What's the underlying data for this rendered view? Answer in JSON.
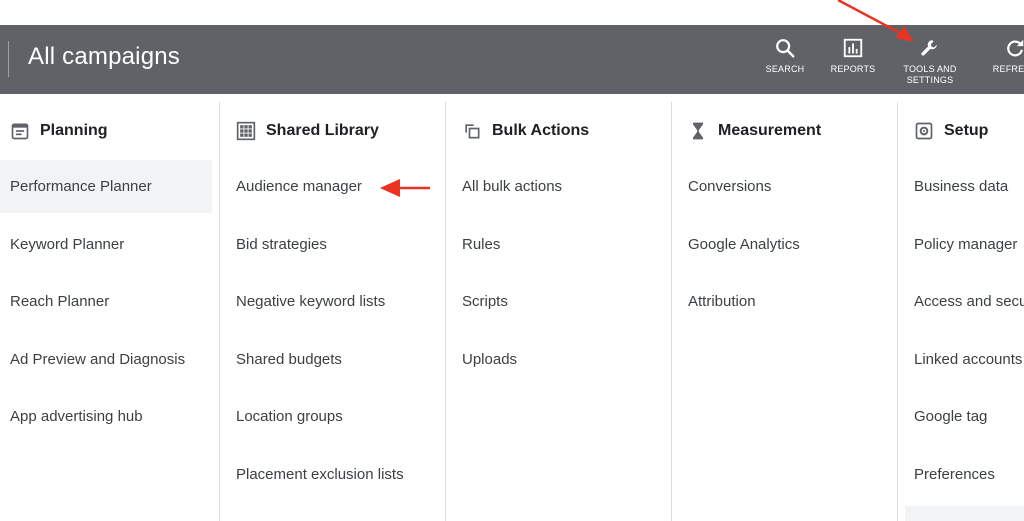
{
  "header": {
    "title": "All campaigns",
    "buttons": [
      {
        "id": "search",
        "label": "SEARCH",
        "icon": "search-icon"
      },
      {
        "id": "reports",
        "label": "REPORTS",
        "icon": "bar-chart-icon"
      },
      {
        "id": "tools",
        "label": "TOOLS AND SETTINGS",
        "icon": "wrench-icon"
      },
      {
        "id": "refresh",
        "label": "REFRESH",
        "icon": "refresh-icon"
      }
    ]
  },
  "columns": [
    {
      "id": "planning",
      "heading": "Planning",
      "icon": "calendar-icon",
      "items": [
        "Performance Planner",
        "Keyword Planner",
        "Reach Planner",
        "Ad Preview and Diagnosis",
        "App advertising hub"
      ]
    },
    {
      "id": "shared-library",
      "heading": "Shared Library",
      "icon": "grid-icon",
      "items": [
        "Audience manager",
        "Bid strategies",
        "Negative keyword lists",
        "Shared budgets",
        "Location groups",
        "Placement exclusion lists"
      ]
    },
    {
      "id": "bulk-actions",
      "heading": "Bulk Actions",
      "icon": "copy-icon",
      "items": [
        "All bulk actions",
        "Rules",
        "Scripts",
        "Uploads"
      ]
    },
    {
      "id": "measurement",
      "heading": "Measurement",
      "icon": "hourglass-icon",
      "items": [
        "Conversions",
        "Google Analytics",
        "Attribution"
      ]
    },
    {
      "id": "setup",
      "heading": "Setup",
      "icon": "gear-icon",
      "items": [
        "Business data",
        "Policy manager",
        "Access and security",
        "Linked accounts",
        "Google tag",
        "Preferences"
      ]
    }
  ],
  "selected_item": "Performance Planner",
  "colors": {
    "header_bg": "#5f6368",
    "selected_bg": "#f1f3f4",
    "arrow": "#ea3323",
    "divider": "#dadce0"
  }
}
